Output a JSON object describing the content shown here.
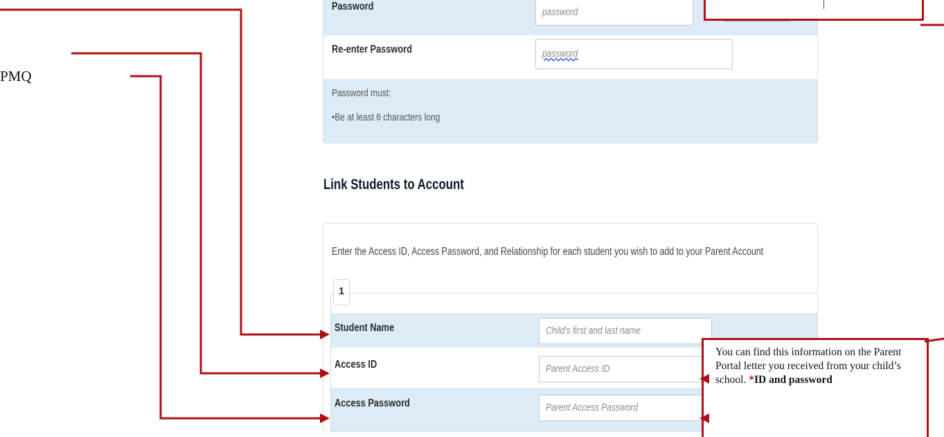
{
  "password_section": {
    "password_label": "Password",
    "password_placeholder": "password",
    "reenter_label": "Re-enter Password",
    "reenter_placeholder": "password",
    "rules_heading": "Password must:",
    "rule_1": "•Be at least 6 characters long"
  },
  "link_section": {
    "title": "Link Students to Account",
    "instructions": "Enter the Access ID, Access Password, and Relationship for each student you wish to add to your Parent Account",
    "student_number": "1",
    "student_name_label": "Student Name",
    "student_name_placeholder": "Child's first and last name",
    "access_id_label": "Access ID",
    "access_id_placeholder": "Parent Access ID",
    "access_password_label": "Access Password",
    "access_password_placeholder": "Parent Access Password"
  },
  "annotations": {
    "left_fragment": "PMQ",
    "callout_text_1": "You can find this information on the Parent Portal letter you received from your child’s school. ",
    "callout_asterisk": "*",
    "callout_bold": "ID and password"
  },
  "colors": {
    "band_blue": "#dcebf5",
    "annotation_red": "#b00f14",
    "title_navy": "#0c1a2e"
  }
}
